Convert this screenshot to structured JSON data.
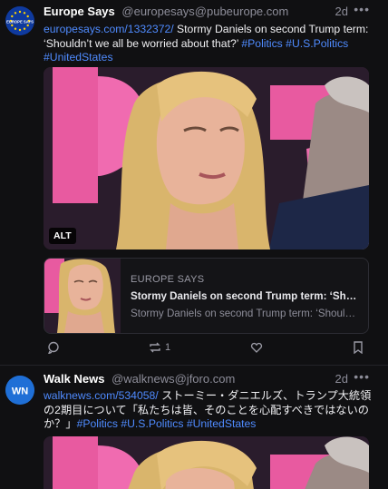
{
  "posts": [
    {
      "author": "Europe Says",
      "handle": "@europesays@pubeurope.com",
      "time": "2d",
      "avatar_label": "EUROPE SAYS",
      "text": {
        "link": "europesays.com/1332372/",
        "main": " Stormy Daniels on second Trump term: ‘Shouldn’t we all be worried about that?’ ",
        "tags": [
          "#Politics",
          "#U.S.Politics",
          "#UnitedStates"
        ]
      },
      "media_alt_badge": "ALT",
      "card": {
        "site": "EUROPE SAYS",
        "title": "Stormy Daniels on second Trump term: ‘Shouldn’t...",
        "description": "Stormy Daniels on second Trump term: ‘Shouldn’t..."
      },
      "boost_count": "1"
    },
    {
      "author": "Walk News",
      "handle": "@walknews@jforo.com",
      "time": "2d",
      "avatar_label": "WN",
      "text": {
        "link": "walknews.com/534058/",
        "main": " ストーミー・ダニエルズ、トランプ大統領の2期目について「私たちは皆、そのことを心配すべきではないのか？」",
        "tags": [
          "#Politics",
          "#U.S.Politics",
          "#UnitedStates"
        ]
      }
    }
  ],
  "colors": {
    "background": "#101012",
    "link": "#4f8bff",
    "muted": "#8d8d99",
    "wn_blue": "#1f6fd6",
    "eu_blue": "#0f3a9e",
    "eu_stars": "#ffd400"
  },
  "icons": [
    "reply-icon",
    "boost-icon",
    "favourite-icon",
    "bookmark-icon",
    "more-icon"
  ]
}
